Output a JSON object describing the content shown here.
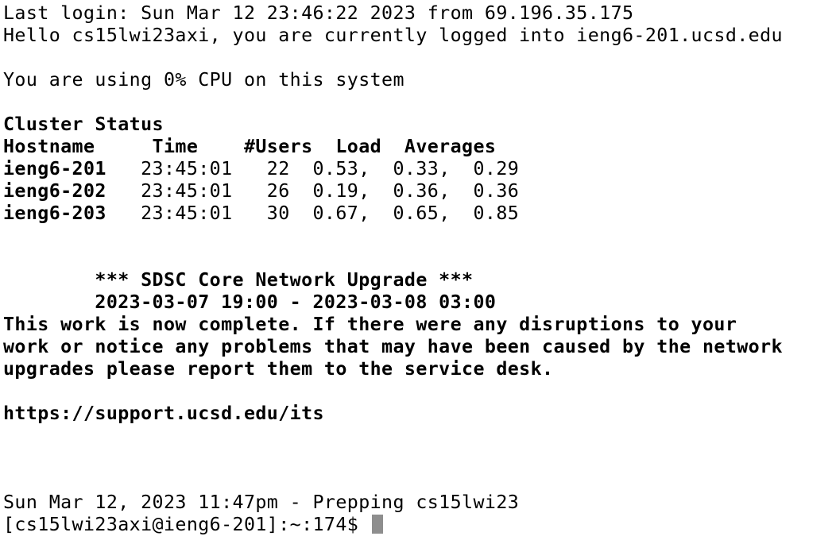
{
  "terminal": {
    "last_login": "Last login: Sun Mar 12 23:46:22 2023 from 69.196.35.175",
    "hello": "Hello cs15lwi23axi, you are currently logged into ieng6-201.ucsd.edu",
    "cpu": "You are using 0% CPU on this system",
    "cluster_title": "Cluster Status",
    "cluster_header": "Hostname     Time    #Users  Load  Averages",
    "cluster_rows": [
      {
        "host": "ieng6-201",
        "rest": "   23:45:01   22  0.53,  0.33,  0.29"
      },
      {
        "host": "ieng6-202",
        "rest": "   23:45:01   26  0.19,  0.36,  0.36"
      },
      {
        "host": "ieng6-203",
        "rest": "   23:45:01   30  0.67,  0.65,  0.85"
      }
    ],
    "notice": {
      "title": "        *** SDSC Core Network Upgrade ***",
      "window": "        2023-03-07 19:00 - 2023-03-08 03:00",
      "body": [
        "This work is now complete. If there were any disruptions to your",
        "work or notice any problems that may have been caused by the network",
        "upgrades please report them to the service desk."
      ],
      "link": "https://support.ucsd.edu/its"
    },
    "status_line": "Sun Mar 12, 2023 11:47pm - Prepping cs15lwi23",
    "prompt": "[cs15lwi23axi@ieng6-201]:~:174$"
  }
}
